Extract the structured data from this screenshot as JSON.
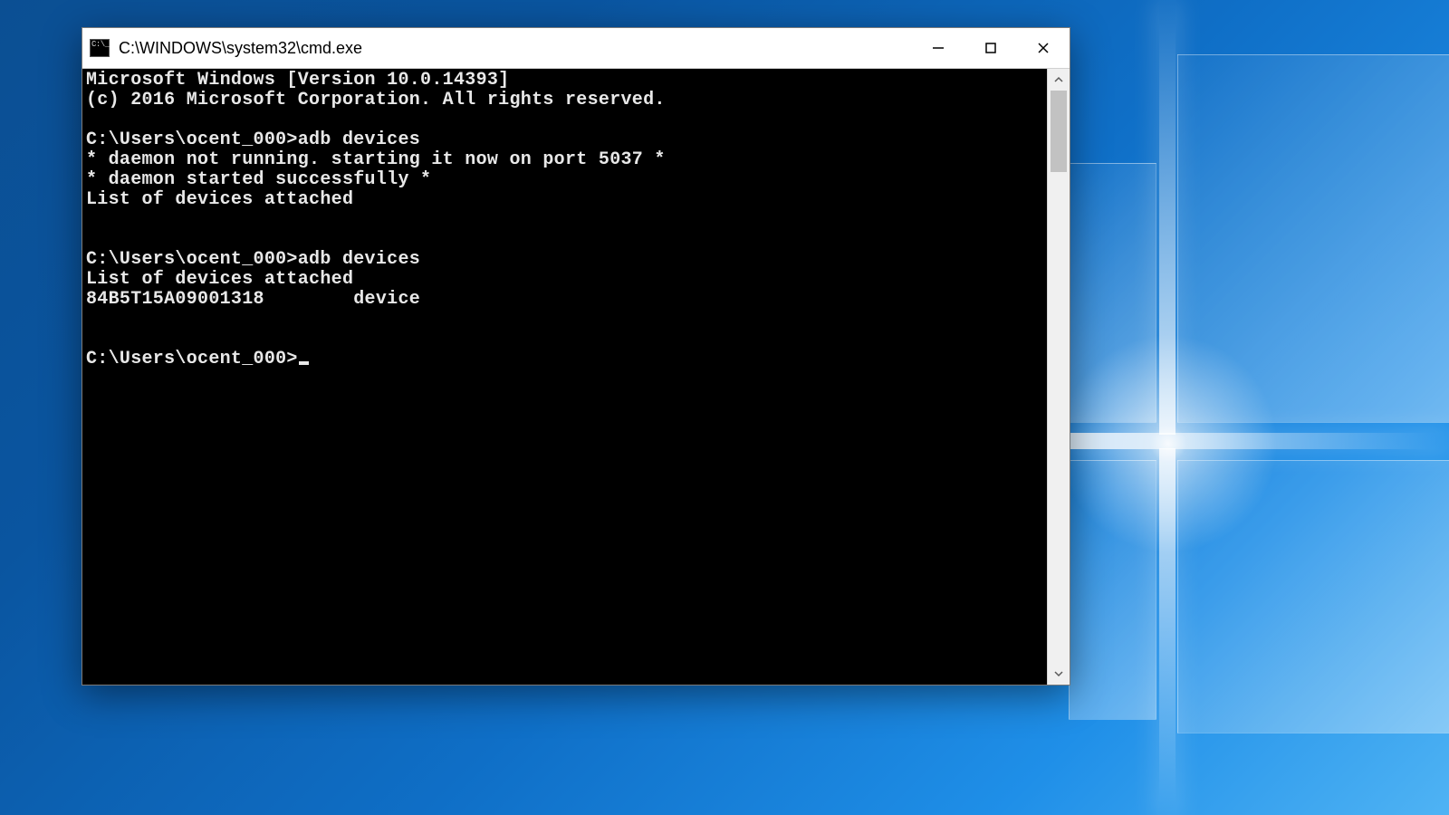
{
  "window": {
    "title": "C:\\WINDOWS\\system32\\cmd.exe"
  },
  "console": {
    "lines": [
      "Microsoft Windows [Version 10.0.14393]",
      "(c) 2016 Microsoft Corporation. All rights reserved.",
      "",
      "C:\\Users\\ocent_000>adb devices",
      "* daemon not running. starting it now on port 5037 *",
      "* daemon started successfully *",
      "List of devices attached",
      "",
      "",
      "C:\\Users\\ocent_000>adb devices",
      "List of devices attached",
      "84B5T15A09001318        device",
      "",
      ""
    ],
    "prompt": "C:\\Users\\ocent_000>"
  }
}
